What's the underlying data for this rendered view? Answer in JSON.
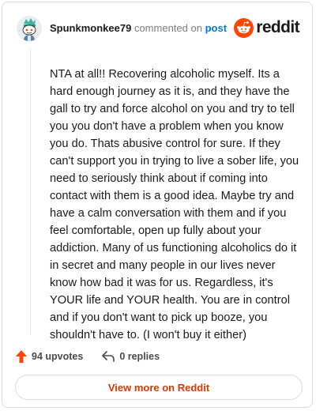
{
  "header": {
    "username": "Spunkmonkee79",
    "commented_text": "commented on",
    "post_link": "post",
    "logo_text": "reddit"
  },
  "comment": {
    "body": "NTA at all!! Recovering alcoholic myself. Its a hard enough journey as it is, and they have the gall to try and force alcohol on you and try to tell you you don't have a problem when you know you do. Thats abusive control for sure. If they can't support you in trying to live a sober life, you need to seriously think about if coming into contact with them is a good idea. Maybe try and have a calm conversation with them and if you feel comfortable, open up fully about your addiction. Many of us functioning alcoholics do it in secret and many people in our lives never know how bad it was for us. Regardless, it's YOUR life and YOUR health. You are in control and if you don't want to pick up booze, you shouldn't have to. (I won't buy it either)"
  },
  "actions": {
    "upvotes_label": "94 upvotes",
    "replies_label": "0 replies"
  },
  "footer": {
    "view_more_label": "View more on Reddit"
  },
  "colors": {
    "brand_orange": "#ff4500",
    "link_blue": "#0079d3",
    "view_more_text": "#d93a00",
    "upvote_icon": "#ff4500",
    "border": "#d9dcdf"
  },
  "icons": {
    "avatar": "snoo-avatar-icon",
    "logo": "reddit-snoo-icon",
    "upvote": "upvote-arrow-icon",
    "reply": "reply-arrow-icon"
  }
}
